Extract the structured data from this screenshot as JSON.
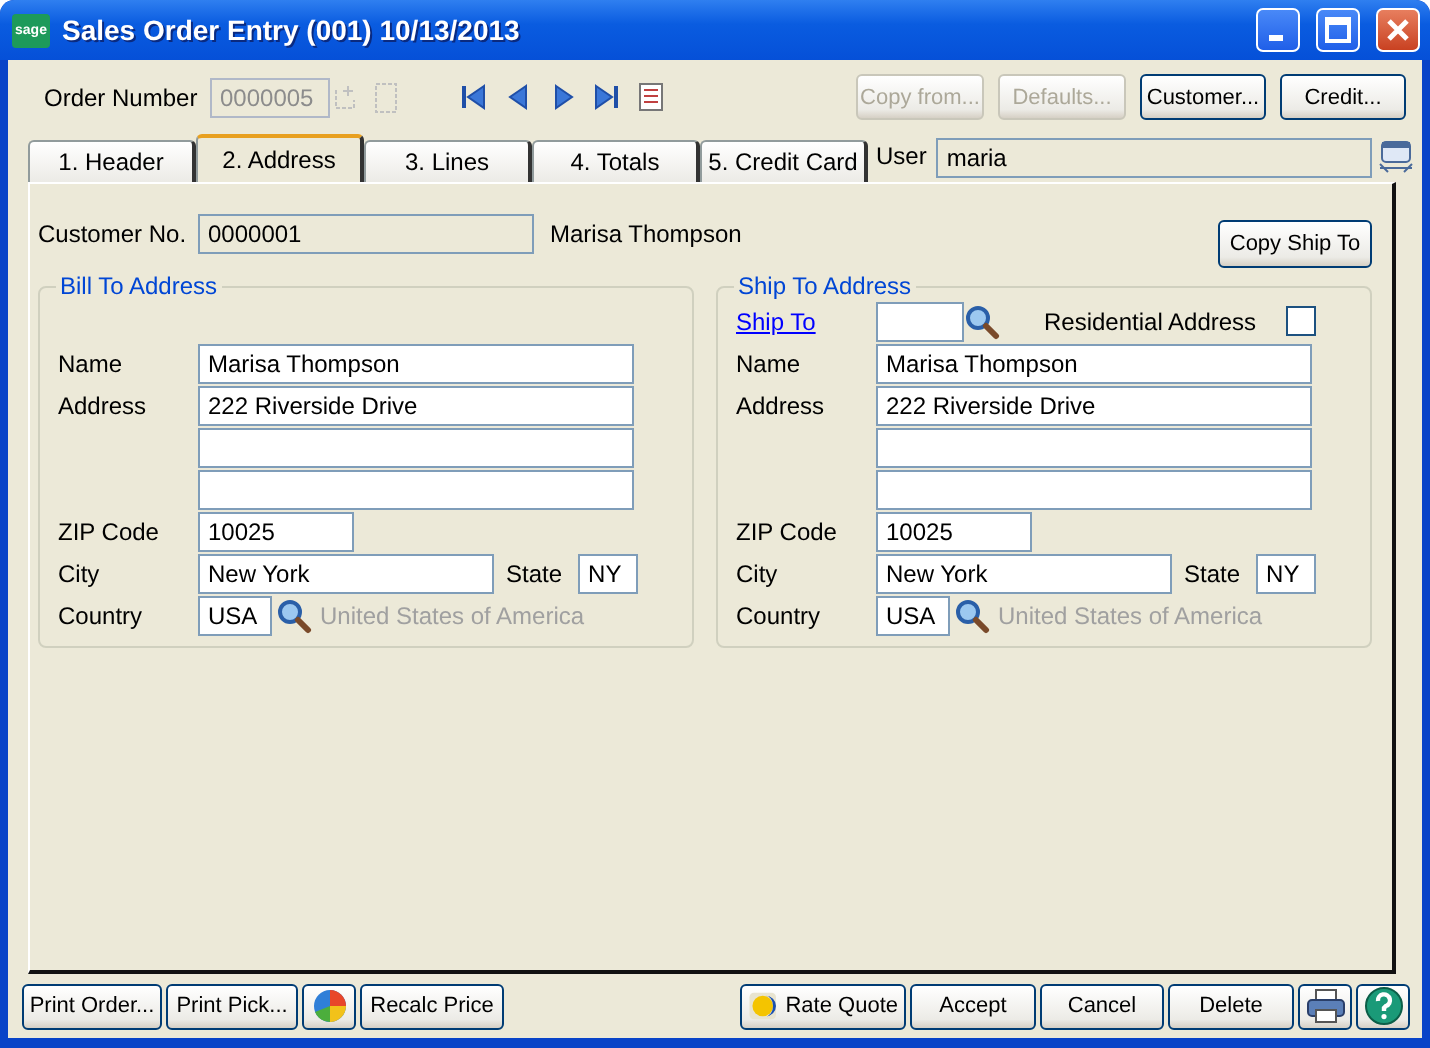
{
  "window": {
    "logo": "sage",
    "title": "Sales Order Entry (001) 10/13/2013"
  },
  "order_number": {
    "label": "Order Number",
    "value": "0000005",
    "disabled": true
  },
  "top_buttons": [
    {
      "label": "Copy from...",
      "disabled": true
    },
    {
      "label": "Defaults...",
      "disabled": true
    },
    {
      "label": "Customer...",
      "disabled": false
    },
    {
      "label": "Credit...",
      "disabled": false
    }
  ],
  "tabs": [
    {
      "label": "1. Header",
      "selected": false
    },
    {
      "label": "2. Address",
      "selected": true
    },
    {
      "label": "3. Lines",
      "selected": false
    },
    {
      "label": "4. Totals",
      "selected": false
    },
    {
      "label": "5. Credit Card",
      "selected": false
    }
  ],
  "user": {
    "label": "User",
    "value": "maria"
  },
  "customer": {
    "label": "Customer No.",
    "value": "0000001",
    "name": "Marisa Thompson"
  },
  "copy_ship_to": "Copy Ship To",
  "bill_to": {
    "title": "Bill To Address",
    "name": {
      "label": "Name",
      "value": "Marisa Thompson"
    },
    "address": {
      "label": "Address",
      "lines": [
        "222 Riverside Drive"
      ]
    },
    "zip": {
      "label": "ZIP Code",
      "value": "10025"
    },
    "city": {
      "label": "City",
      "value": "New York"
    },
    "state": {
      "label": "State",
      "value": "NY"
    },
    "country": {
      "label": "Country",
      "value": "USA",
      "description": "United States of America"
    }
  },
  "ship_to": {
    "title": "Ship To Address",
    "ship_to_link": "Ship To",
    "residential": {
      "label": "Residential Address",
      "checked": false
    },
    "name": {
      "label": "Name",
      "value": "Marisa Thompson"
    },
    "address": {
      "label": "Address",
      "lines": [
        "222 Riverside Drive"
      ]
    },
    "zip": {
      "label": "ZIP Code",
      "value": "10025"
    },
    "city": {
      "label": "City",
      "value": "New York"
    },
    "state": {
      "label": "State",
      "value": "NY"
    },
    "country": {
      "label": "Country",
      "value": "USA",
      "description": "United States of America"
    }
  },
  "footer_left": [
    {
      "kind": "text",
      "label": "Print Order..."
    },
    {
      "kind": "text",
      "label": "Print Pick..."
    },
    {
      "kind": "pie"
    },
    {
      "kind": "text",
      "label": "Recalc Price"
    }
  ],
  "footer_right": [
    {
      "kind": "quote",
      "label": "Rate Quote"
    },
    {
      "kind": "text",
      "label": "Accept"
    },
    {
      "kind": "text",
      "label": "Cancel"
    },
    {
      "kind": "text",
      "label": "Delete"
    },
    {
      "kind": "printer"
    },
    {
      "kind": "help"
    }
  ]
}
